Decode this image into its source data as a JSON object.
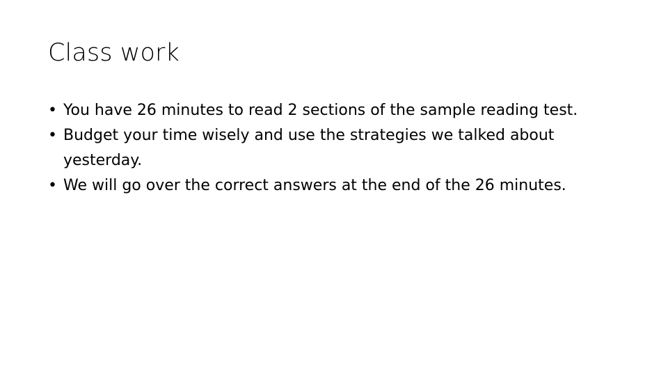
{
  "slide": {
    "background_color": "#ffffff",
    "text_color": "#000000",
    "title": "Class work",
    "bullet_glyph": "•",
    "bullets": [
      {
        "marker": "•",
        "text": "You have 26 minutes to read 2 sections of the sample reading test."
      },
      {
        "marker": "•",
        "text": "Budget your time wisely and use the strategies we talked about yesterday."
      },
      {
        "marker": "•",
        "text": "We will go over the correct answers at the end of the 26 minutes."
      }
    ]
  }
}
